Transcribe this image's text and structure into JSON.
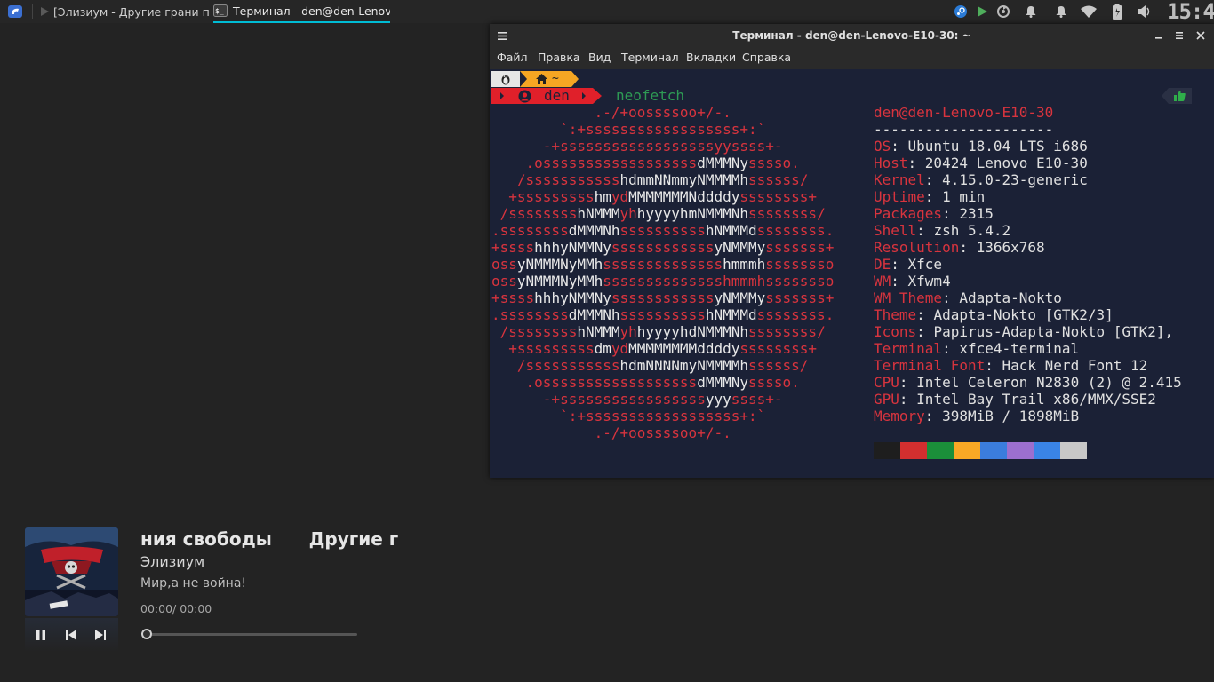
{
  "panel": {
    "taskbar": [
      {
        "label": "[Элизиум - Другие грани по...",
        "active": false
      },
      {
        "label": "Терминал - den@den-Lenov...",
        "active": true
      }
    ],
    "clock": "15:4"
  },
  "terminal": {
    "title": "Терминал - den@den-Lenovo-E10-30: ~",
    "menu": [
      "Файл",
      "Правка",
      "Вид",
      "Терминал",
      "Вкладки",
      "Справка"
    ],
    "prompt": {
      "dir": "~",
      "user": "den",
      "command": "neofetch"
    },
    "ascii_art": [
      [
        {
          "t": "            .-/+oossssoo+/-.",
          "c": "r"
        }
      ],
      [
        {
          "t": "        `:+ssssssssssssssssss+:`",
          "c": "r"
        }
      ],
      [
        {
          "t": "      -+ssssssssssssssssssyyssss+-",
          "c": "r"
        }
      ],
      [
        {
          "t": "    .ossssssssssssssssss",
          "c": "r"
        },
        {
          "t": "dMMMNy",
          "c": "w"
        },
        {
          "t": "sssso.",
          "c": "r"
        }
      ],
      [
        {
          "t": "   /sssssssssss",
          "c": "r"
        },
        {
          "t": "hdmmNNmmyNMMMMh",
          "c": "w"
        },
        {
          "t": "ssssss/",
          "c": "r"
        }
      ],
      [
        {
          "t": "  +sssssssss",
          "c": "r"
        },
        {
          "t": "hm",
          "c": "w"
        },
        {
          "t": "yd",
          "c": "r"
        },
        {
          "t": "MMMMMMMNddddy",
          "c": "w"
        },
        {
          "t": "ssssssss+",
          "c": "r"
        }
      ],
      [
        {
          "t": " /ssssssss",
          "c": "r"
        },
        {
          "t": "hNMMM",
          "c": "w"
        },
        {
          "t": "yh",
          "c": "r"
        },
        {
          "t": "hyyyyhmNMMMNh",
          "c": "w"
        },
        {
          "t": "ssssssss/",
          "c": "r"
        }
      ],
      [
        {
          "t": ".ssssssss",
          "c": "r"
        },
        {
          "t": "dMMMNh",
          "c": "w"
        },
        {
          "t": "ssssssssss",
          "c": "r"
        },
        {
          "t": "hNMMMd",
          "c": "w"
        },
        {
          "t": "ssssssss.",
          "c": "r"
        }
      ],
      [
        {
          "t": "+ssss",
          "c": "r"
        },
        {
          "t": "hhhyNMMNy",
          "c": "w"
        },
        {
          "t": "ssssssssssss",
          "c": "r"
        },
        {
          "t": "yNMMMy",
          "c": "w"
        },
        {
          "t": "sssssss+",
          "c": "r"
        }
      ],
      [
        {
          "t": "oss",
          "c": "r"
        },
        {
          "t": "yNMMMNyMMh",
          "c": "w"
        },
        {
          "t": "ssssssssssssss",
          "c": "r"
        },
        {
          "t": "hmmmh",
          "c": "w"
        },
        {
          "t": "ssssssso",
          "c": "r"
        }
      ],
      [
        {
          "t": "oss",
          "c": "r"
        },
        {
          "t": "yNMMMNyMMh",
          "c": "w"
        },
        {
          "t": "sssssssssssssshmmmh",
          "c": "r"
        },
        {
          "t": "ssssssso",
          "c": "r"
        }
      ],
      [
        {
          "t": "+ssss",
          "c": "r"
        },
        {
          "t": "hhhyNMMNy",
          "c": "w"
        },
        {
          "t": "ssssssssssss",
          "c": "r"
        },
        {
          "t": "yNMMMy",
          "c": "w"
        },
        {
          "t": "sssssss+",
          "c": "r"
        }
      ],
      [
        {
          "t": ".ssssssss",
          "c": "r"
        },
        {
          "t": "dMMMNh",
          "c": "w"
        },
        {
          "t": "ssssssssss",
          "c": "r"
        },
        {
          "t": "hNMMMd",
          "c": "w"
        },
        {
          "t": "ssssssss.",
          "c": "r"
        }
      ],
      [
        {
          "t": " /ssssssss",
          "c": "r"
        },
        {
          "t": "hNMMM",
          "c": "w"
        },
        {
          "t": "yh",
          "c": "r"
        },
        {
          "t": "hyyyyhdNMMMNh",
          "c": "w"
        },
        {
          "t": "ssssssss/",
          "c": "r"
        }
      ],
      [
        {
          "t": "  +sssssssss",
          "c": "r"
        },
        {
          "t": "dm",
          "c": "w"
        },
        {
          "t": "yd",
          "c": "r"
        },
        {
          "t": "MMMMMMMMddddy",
          "c": "w"
        },
        {
          "t": "ssssssss+",
          "c": "r"
        }
      ],
      [
        {
          "t": "   /sssssssssss",
          "c": "r"
        },
        {
          "t": "hdmNNNNmyNMMMMh",
          "c": "w"
        },
        {
          "t": "ssssss/",
          "c": "r"
        }
      ],
      [
        {
          "t": "    .ossssssssssssssssss",
          "c": "r"
        },
        {
          "t": "dMMMNy",
          "c": "w"
        },
        {
          "t": "sssso.",
          "c": "r"
        }
      ],
      [
        {
          "t": "      -+sssssssssssssssss",
          "c": "r"
        },
        {
          "t": "yyy",
          "c": "w"
        },
        {
          "t": "ssss+-",
          "c": "r"
        }
      ],
      [
        {
          "t": "        `:+ssssssssssssssssss+:`",
          "c": "r"
        }
      ],
      [
        {
          "t": "            .-/+oossssoo+/-.",
          "c": "r"
        }
      ]
    ],
    "info_header": "den@den-Lenovo-E10-30",
    "info_separator": "---------------------",
    "info": [
      {
        "key": "OS",
        "value": "Ubuntu 18.04 LTS i686"
      },
      {
        "key": "Host",
        "value": "20424 Lenovo E10-30"
      },
      {
        "key": "Kernel",
        "value": "4.15.0-23-generic"
      },
      {
        "key": "Uptime",
        "value": "1 min"
      },
      {
        "key": "Packages",
        "value": "2315"
      },
      {
        "key": "Shell",
        "value": "zsh 5.4.2"
      },
      {
        "key": "Resolution",
        "value": "1366x768"
      },
      {
        "key": "DE",
        "value": "Xfce"
      },
      {
        "key": "WM",
        "value": "Xfwm4"
      },
      {
        "key": "WM Theme",
        "value": "Adapta-Nokto"
      },
      {
        "key": "Theme",
        "value": "Adapta-Nokto [GTK2/3]"
      },
      {
        "key": "Icons",
        "value": "Papirus-Adapta-Nokto [GTK2],"
      },
      {
        "key": "Terminal",
        "value": "xfce4-terminal"
      },
      {
        "key": "Terminal Font",
        "value": "Hack Nerd Font 12"
      },
      {
        "key": "CPU",
        "value": "Intel Celeron N2830 (2) @ 2.415"
      },
      {
        "key": "GPU",
        "value": "Intel Bay Trail x86/MMX/SSE2"
      },
      {
        "key": "Memory",
        "value": "398MiB / 1898MiB"
      }
    ],
    "palette": [
      "#1e1e1e",
      "#d32f2f",
      "#1b8f3a",
      "#f9a825",
      "#3b7ddd",
      "#9c6fcf",
      "#3a84e6",
      "#c8c8c8"
    ]
  },
  "player": {
    "title": "ния свободы      Другие г",
    "artist": "Элизиум",
    "album": "Мир,а не война!",
    "time": "00:00/ 00:00",
    "progress": 0
  },
  "colors": {
    "accent": "#00bcd4",
    "prompt_red": "#e0202a",
    "prompt_orange": "#f5a623"
  }
}
